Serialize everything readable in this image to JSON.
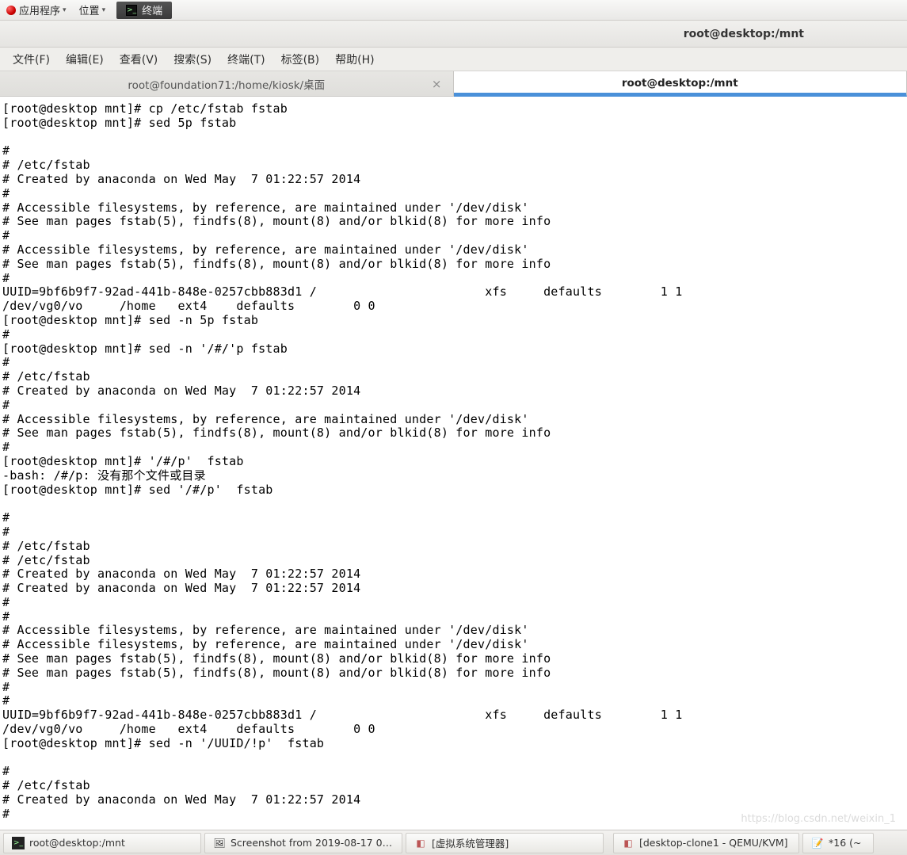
{
  "panel": {
    "apps": "应用程序",
    "places": "位置",
    "task_label": "终端"
  },
  "window": {
    "title": "root@desktop:/mnt"
  },
  "menubar": {
    "file": "文件(F)",
    "edit": "编辑(E)",
    "view": "查看(V)",
    "search": "搜索(S)",
    "terminal": "终端(T)",
    "tabs": "标签(B)",
    "help": "帮助(H)"
  },
  "tabs": {
    "t1": "root@foundation71:/home/kiosk/桌面",
    "t2": "root@desktop:/mnt"
  },
  "terminal_lines": [
    "[root@desktop mnt]# cp /etc/fstab fstab",
    "[root@desktop mnt]# sed 5p fstab",
    "",
    "#",
    "# /etc/fstab",
    "# Created by anaconda on Wed May  7 01:22:57 2014",
    "#",
    "# Accessible filesystems, by reference, are maintained under '/dev/disk'",
    "# See man pages fstab(5), findfs(8), mount(8) and/or blkid(8) for more info",
    "#",
    "# Accessible filesystems, by reference, are maintained under '/dev/disk'",
    "# See man pages fstab(5), findfs(8), mount(8) and/or blkid(8) for more info",
    "#",
    "UUID=9bf6b9f7-92ad-441b-848e-0257cbb883d1 /                       xfs     defaults        1 1",
    "/dev/vg0/vo     /home   ext4    defaults        0 0",
    "[root@desktop mnt]# sed -n 5p fstab",
    "#",
    "[root@desktop mnt]# sed -n '/#/'p fstab",
    "#",
    "# /etc/fstab",
    "# Created by anaconda on Wed May  7 01:22:57 2014",
    "#",
    "# Accessible filesystems, by reference, are maintained under '/dev/disk'",
    "# See man pages fstab(5), findfs(8), mount(8) and/or blkid(8) for more info",
    "#",
    "[root@desktop mnt]# '/#/p'  fstab",
    "-bash: /#/p: 没有那个文件或目录",
    "[root@desktop mnt]# sed '/#/p'  fstab",
    "",
    "#",
    "#",
    "# /etc/fstab",
    "# /etc/fstab",
    "# Created by anaconda on Wed May  7 01:22:57 2014",
    "# Created by anaconda on Wed May  7 01:22:57 2014",
    "#",
    "#",
    "# Accessible filesystems, by reference, are maintained under '/dev/disk'",
    "# Accessible filesystems, by reference, are maintained under '/dev/disk'",
    "# See man pages fstab(5), findfs(8), mount(8) and/or blkid(8) for more info",
    "# See man pages fstab(5), findfs(8), mount(8) and/or blkid(8) for more info",
    "#",
    "#",
    "UUID=9bf6b9f7-92ad-441b-848e-0257cbb883d1 /                       xfs     defaults        1 1",
    "/dev/vg0/vo     /home   ext4    defaults        0 0",
    "[root@desktop mnt]# sed -n '/UUID/!p'  fstab",
    "",
    "#",
    "# /etc/fstab",
    "# Created by anaconda on Wed May  7 01:22:57 2014",
    "#"
  ],
  "taskbar": {
    "t1": "root@desktop:/mnt",
    "t2": "Screenshot from 2019-08-17 0…",
    "t3": "[虚拟系统管理器]",
    "t4": "[desktop-clone1 - QEMU/KVM]",
    "t5": "*16 (~"
  },
  "watermark": "https://blog.csdn.net/weixin_1"
}
